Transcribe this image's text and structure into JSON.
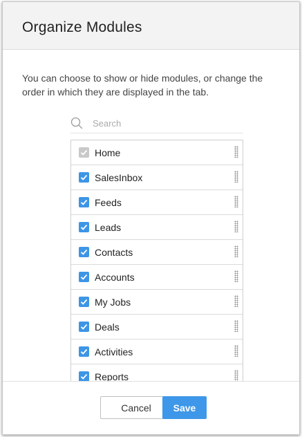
{
  "dialog": {
    "title": "Organize Modules",
    "description": "You can choose to show or hide modules, or change the order in which they are displayed in the tab."
  },
  "search": {
    "placeholder": "Search"
  },
  "modules": [
    {
      "label": "Home",
      "checked": true,
      "disabled": true
    },
    {
      "label": "SalesInbox",
      "checked": true,
      "disabled": false
    },
    {
      "label": "Feeds",
      "checked": true,
      "disabled": false
    },
    {
      "label": "Leads",
      "checked": true,
      "disabled": false
    },
    {
      "label": "Contacts",
      "checked": true,
      "disabled": false
    },
    {
      "label": "Accounts",
      "checked": true,
      "disabled": false
    },
    {
      "label": "My Jobs",
      "checked": true,
      "disabled": false
    },
    {
      "label": "Deals",
      "checked": true,
      "disabled": false
    },
    {
      "label": "Activities",
      "checked": true,
      "disabled": false
    },
    {
      "label": "Reports",
      "checked": true,
      "disabled": false
    }
  ],
  "footer": {
    "cancel_label": "Cancel",
    "save_label": "Save"
  },
  "colors": {
    "accent": "#3e97e8",
    "checkbox": "#3d95e6",
    "checkbox_disabled": "#c9c9c9"
  },
  "icons": {
    "search": "search-icon",
    "drag": "drag-handle-icon",
    "check": "check-icon"
  }
}
